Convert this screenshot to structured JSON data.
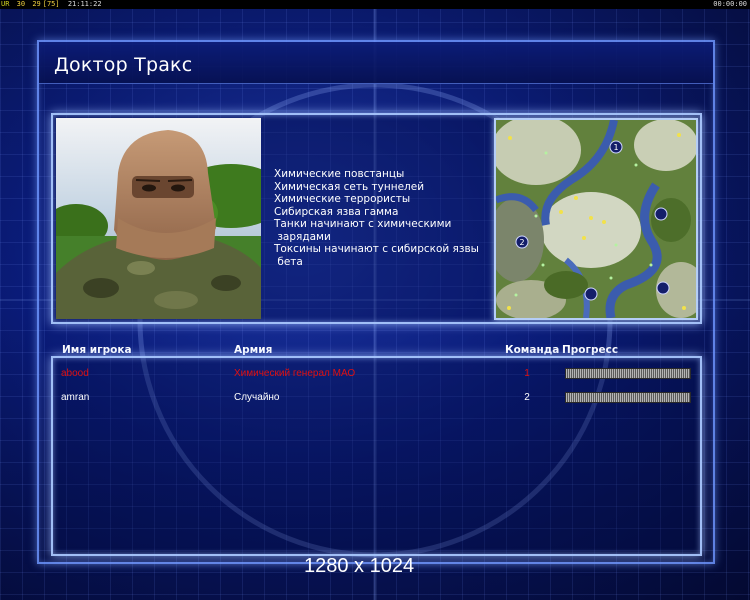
{
  "status_bar": {
    "ur": "UR",
    "fps_a": "30",
    "fps_b": "29",
    "fps_rate": "[75]",
    "clock": "21:11:22",
    "timer": "00:00:00"
  },
  "map": {
    "name": "Доктор Тракс"
  },
  "rules": [
    "Химические повстанцы",
    "Химическая сеть туннелей",
    "Химические террористы",
    "Сибирская язва гамма",
    "Танки начинают с химическими",
    " зарядами",
    "Токсины начинают с сибирской язвы",
    " бета"
  ],
  "minimap": {
    "slots": [
      "1",
      "2"
    ]
  },
  "players_table": {
    "headers": {
      "name": "Имя игрока",
      "army": "Армия",
      "team": "Команда",
      "progress": "Прогресс"
    },
    "rows": [
      {
        "name": "abood",
        "army": "Химический генерал МАО",
        "team": "1",
        "color": "#e01010",
        "progress": 1.0
      },
      {
        "name": "amran",
        "army": "Случайно",
        "team": "2",
        "color": "#ffffff",
        "progress": 1.0
      }
    ]
  },
  "resolution": "1280 x 1024",
  "colors": {
    "accent": "#a8c4ff",
    "player1": "#e01010",
    "background": "#0a1d80"
  }
}
